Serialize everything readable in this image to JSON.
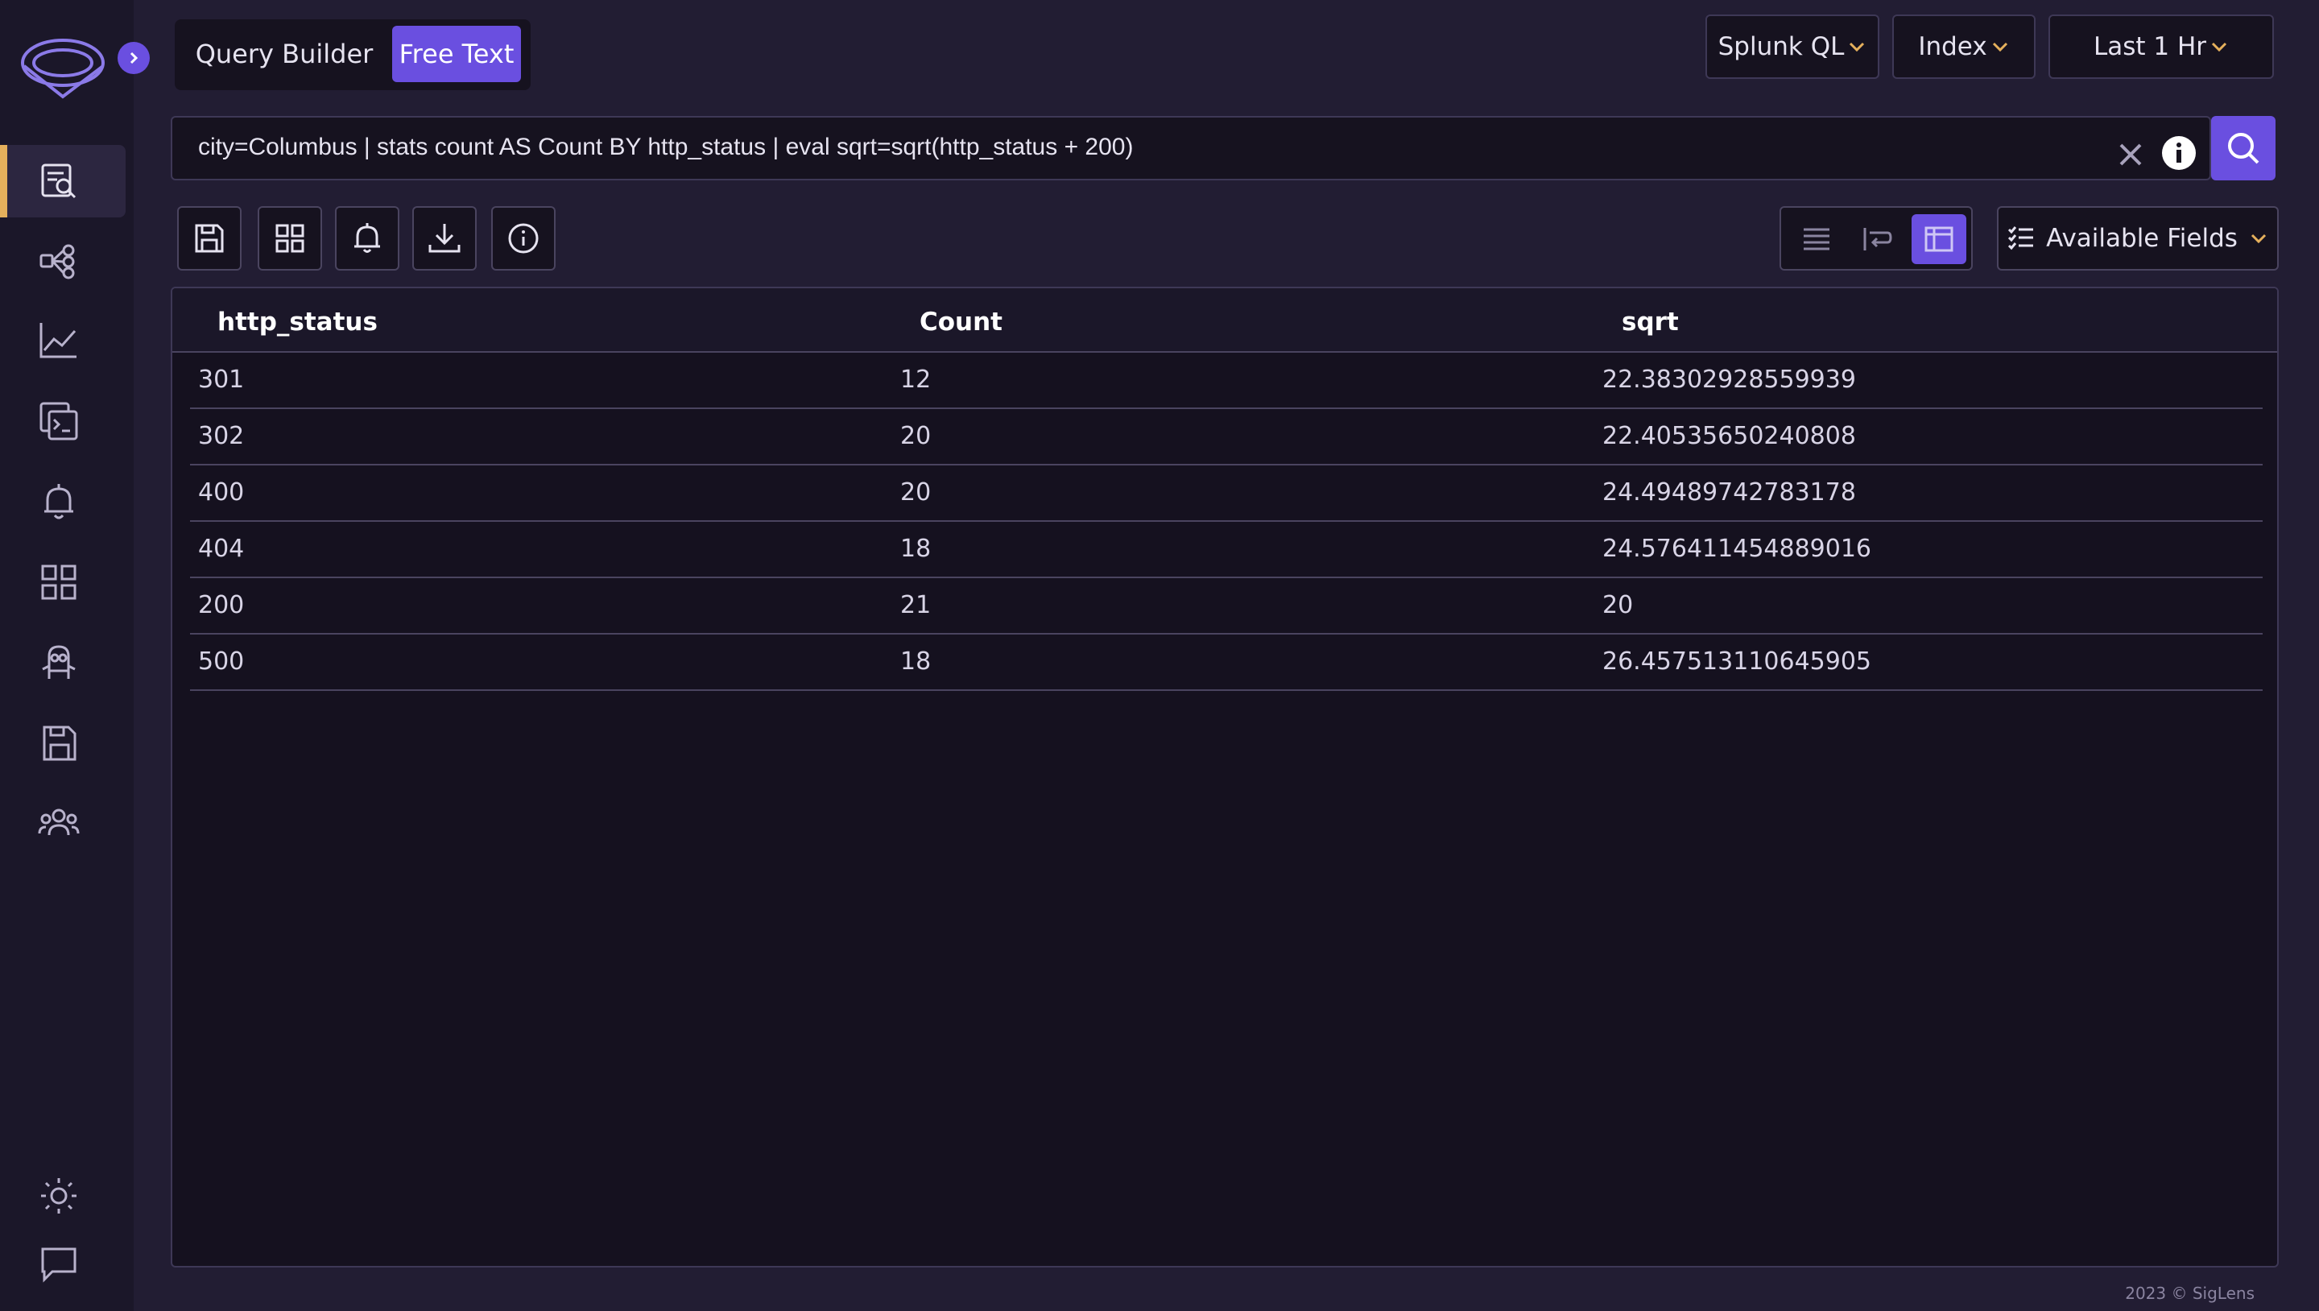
{
  "mode_tabs": {
    "query_builder": "Query Builder",
    "free_text": "Free Text"
  },
  "top_dropdowns": {
    "language": "Splunk QL",
    "index": "Index",
    "time_range": "Last 1 Hr"
  },
  "query": {
    "text": "city=Columbus | stats count AS Count BY http_status | eval sqrt=sqrt(http_status + 200)"
  },
  "toolbar": {
    "available_fields": "Available Fields"
  },
  "table": {
    "headers": [
      "http_status",
      "Count",
      "sqrt"
    ],
    "rows": [
      [
        "301",
        "12",
        "22.38302928559939"
      ],
      [
        "302",
        "20",
        "22.40535650240808"
      ],
      [
        "400",
        "20",
        "24.49489742783178"
      ],
      [
        "404",
        "18",
        "24.576411454889016"
      ],
      [
        "200",
        "21",
        "20"
      ],
      [
        "500",
        "18",
        "26.457513110645905"
      ]
    ]
  },
  "footer": {
    "text": "2023 © SigLens"
  },
  "colors": {
    "accent": "#6a4fe0",
    "highlight": "#e5b05c",
    "background": "#221d33"
  }
}
